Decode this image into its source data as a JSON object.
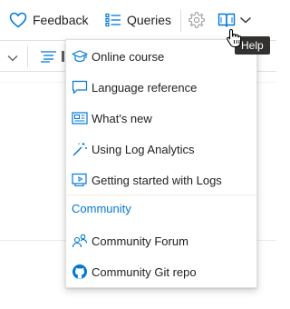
{
  "toolbar": {
    "feedback_label": "Feedback",
    "queries_label": "Queries"
  },
  "help_tooltip": "Help",
  "help_menu": {
    "items": [
      {
        "label": "Online course",
        "icon": "graduation-cap-icon"
      },
      {
        "label": "Language reference",
        "icon": "speech-bubble-icon"
      },
      {
        "label": "What's new",
        "icon": "news-icon"
      },
      {
        "label": "Using Log Analytics",
        "icon": "magic-wand-icon"
      },
      {
        "label": "Getting started with Logs",
        "icon": "presentation-icon"
      }
    ],
    "section_title": "Community",
    "community_items": [
      {
        "label": "Community Forum",
        "icon": "people-icon"
      },
      {
        "label": "Community Git repo",
        "icon": "github-icon"
      }
    ]
  },
  "colors": {
    "accent": "#0078d4",
    "text": "#201f1e",
    "tooltip_bg": "#323130",
    "border": "#e1dfdd"
  }
}
